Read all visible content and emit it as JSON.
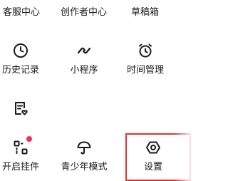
{
  "top_row": {
    "items": [
      {
        "label": "客服中心"
      },
      {
        "label": "创作者中心"
      },
      {
        "label": "草稿箱"
      }
    ]
  },
  "grid": {
    "history": {
      "label": "历史记录",
      "icon": "clock-icon"
    },
    "mini_program": {
      "label": "小程序",
      "icon": "mini-program-icon"
    },
    "time_management": {
      "label": "时间管理",
      "icon": "alarm-clock-icon"
    },
    "orders": {
      "icon": "clipboard-heart-icon"
    },
    "widget": {
      "label": "开启挂件",
      "icon": "widget-icon",
      "badge_color": "#fe2c55"
    },
    "teen_mode": {
      "label": "青少年模式",
      "icon": "umbrella-icon"
    },
    "settings": {
      "label": "设置",
      "icon": "hexagon-settings-icon"
    }
  },
  "colors": {
    "text": "#1a1a1a",
    "badge": "#fe2c55",
    "highlight": "#e8312f"
  }
}
